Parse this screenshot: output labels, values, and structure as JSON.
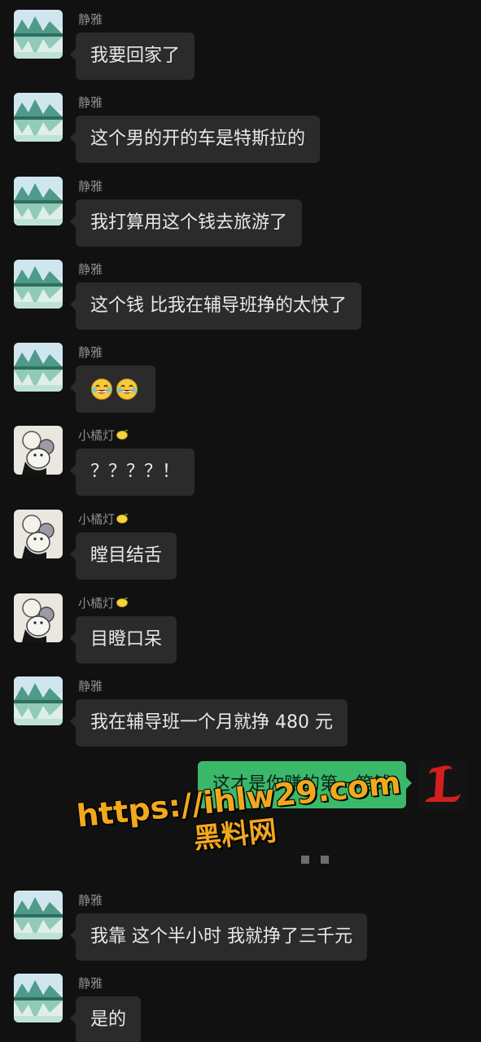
{
  "conversation": {
    "messages": [
      {
        "sender": "静雅",
        "text": "我要回家了",
        "avatar": "lake-icon"
      },
      {
        "sender": "静雅",
        "text": "这个男的开的车是特斯拉的",
        "avatar": "lake-icon"
      },
      {
        "sender": "静雅",
        "text": "我打算用这个钱去旅游了",
        "avatar": "lake-icon"
      },
      {
        "sender": "静雅",
        "text": "这个钱 比我在辅导班挣的太快了",
        "avatar": "lake-icon"
      },
      {
        "sender": "静雅",
        "text": "",
        "emoji": "laughing-crying-face-icon x2",
        "avatar": "lake-icon"
      },
      {
        "sender": "小橘灯",
        "text": "？？？？！",
        "avatar": "cartoon-mouse-icon",
        "badge": "lemon-icon"
      },
      {
        "sender": "小橘灯",
        "text": "瞠目结舌",
        "avatar": "cartoon-mouse-icon",
        "badge": "lemon-icon"
      },
      {
        "sender": "小橘灯",
        "text": "目瞪口呆",
        "avatar": "cartoon-mouse-icon",
        "badge": "lemon-icon"
      },
      {
        "sender": "静雅",
        "text": "我在辅导班一个月就挣 480 元",
        "avatar": "lake-icon"
      },
      {
        "sender": "me",
        "text": "这才是你赚的第一笔钱",
        "avatar": "gothic-L-icon"
      },
      {
        "sender": "静雅",
        "text": "我靠 这个半小时 我就挣了三千元",
        "avatar": "lake-icon"
      },
      {
        "sender": "静雅",
        "text": "是的",
        "avatar": "lake-icon"
      }
    ]
  },
  "watermark": {
    "url": "https://ihlw29.com",
    "site": "黑料网"
  },
  "colors": {
    "background": "#111111",
    "incoming_bubble": "#2b2b2b",
    "outgoing_bubble": "#3ab96b",
    "watermark": "#f2a81d"
  }
}
